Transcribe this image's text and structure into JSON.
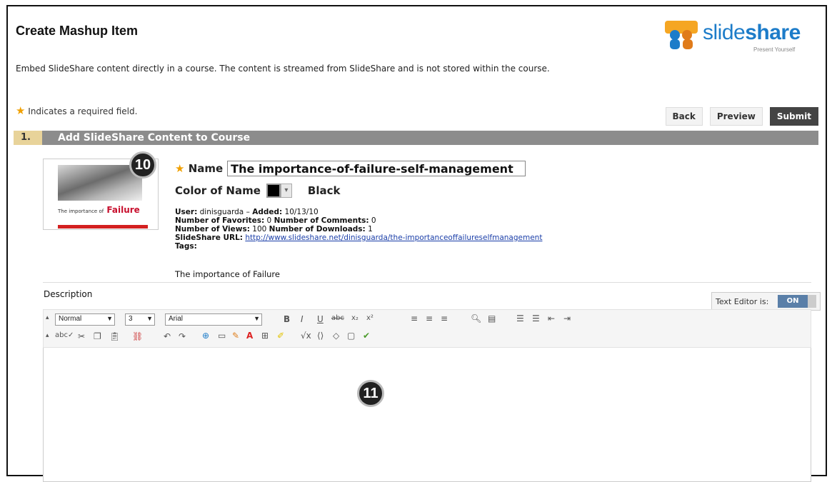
{
  "header": {
    "title": "Create Mashup Item",
    "intro": "Embed SlideShare content directly in a course. The content is streamed from SlideShare and is not stored within the course.",
    "required_note": "Indicates a required field.",
    "logo": {
      "word_light": "slide",
      "word_bold": "share",
      "tagline": "Present Yourself"
    }
  },
  "actions": {
    "back": "Back",
    "preview": "Preview",
    "submit": "Submit"
  },
  "step": {
    "number": "1.",
    "label": "Add SlideShare Content to Course"
  },
  "thumbnail": {
    "title_small": "The importance of",
    "title_big": "Failure"
  },
  "callouts": {
    "badge_10": "10",
    "badge_11": "11"
  },
  "form": {
    "name_label": "Name",
    "name_value": "The importance-of-failure-self-management",
    "color_label": "Color of Name",
    "color_value": "Black",
    "color_hex": "#000000"
  },
  "meta": {
    "user_label": "User:",
    "user_value": "dinisguarda",
    "added_label": "Added:",
    "added_value": "10/13/10",
    "favorites_label": "Number of Favorites:",
    "favorites_value": "0",
    "comments_label": "Number of Comments:",
    "comments_value": "0",
    "views_label": "Number of Views:",
    "views_value": "100",
    "downloads_label": "Number of Downloads:",
    "downloads_value": "1",
    "url_label": "SlideShare URL:",
    "url_value": "http://www.slideshare.net/dinisguarda/the-importanceoffailureselfmanagement",
    "tags_label": "Tags:",
    "tags_value": "The importance of Failure"
  },
  "description": {
    "label": "Description",
    "editor_toggle_label": "Text Editor is:",
    "editor_toggle_state": "ON",
    "format_select": "Normal",
    "size_select": "3",
    "font_select": "Arial"
  },
  "colors": {
    "step_bar": "#8c8c8c",
    "step_num": "#e8d39a",
    "accent_star": "#f0a000",
    "link": "#1a3ea8",
    "toggle_on": "#5a7fa8"
  }
}
